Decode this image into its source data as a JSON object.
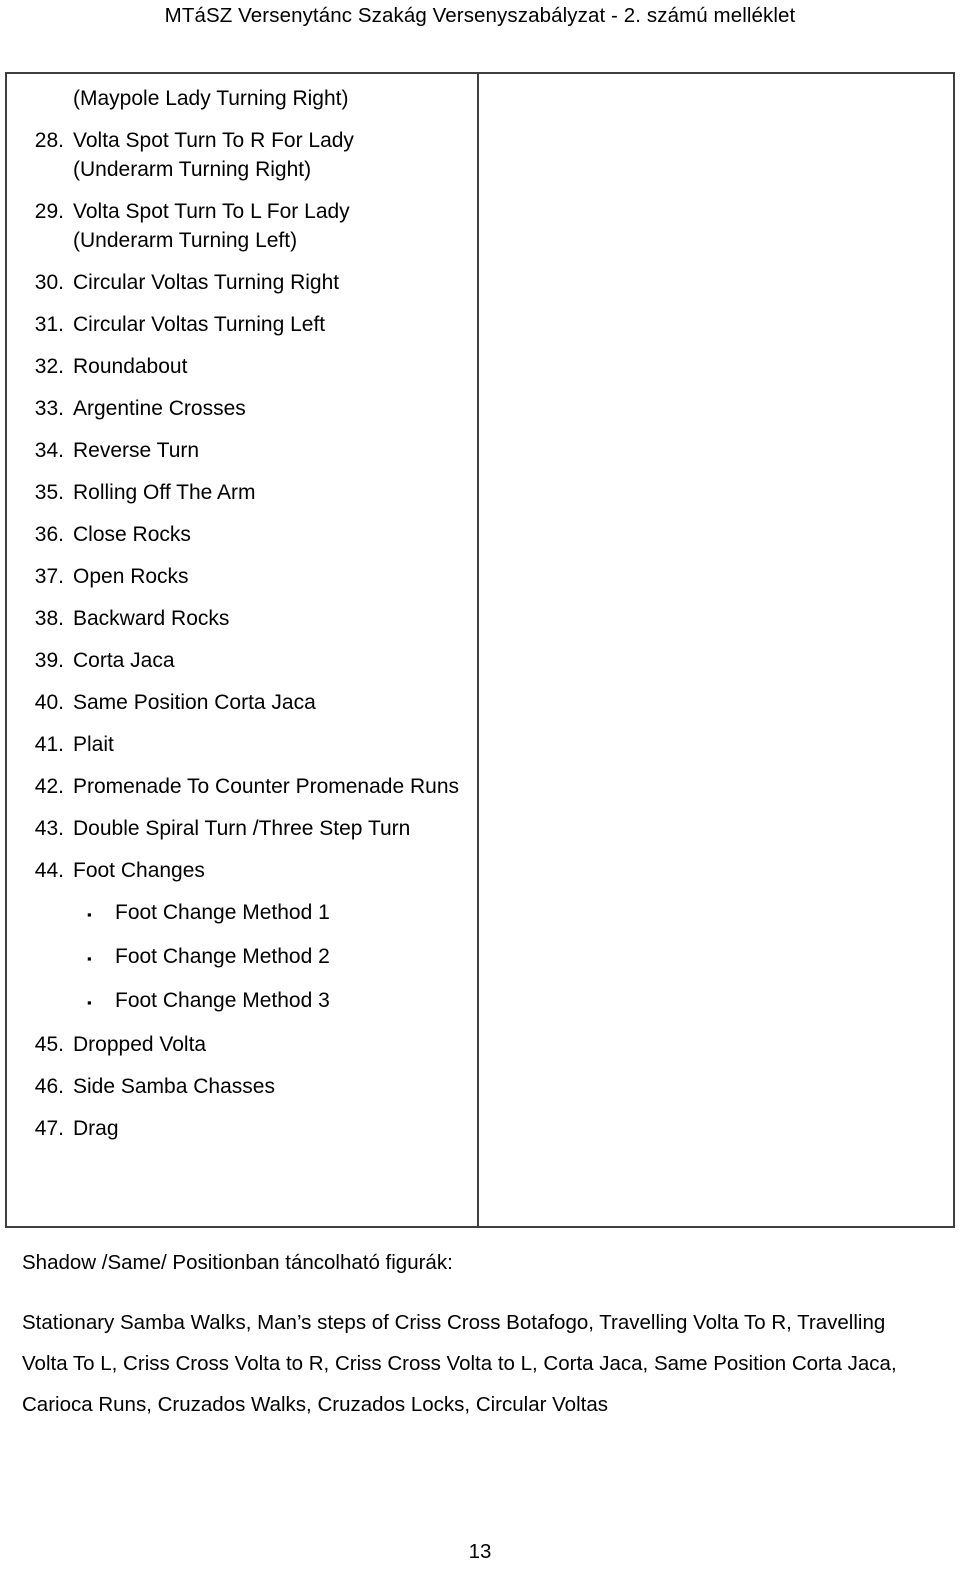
{
  "header": {
    "title": "MTáSZ Versenytánc Szakág Versenyszabályzat - 2. számú melléklet"
  },
  "table": {
    "left_column": {
      "leading_line": "(Maypole Lady Turning Right)",
      "items": [
        {
          "num": "28.",
          "label": "Volta Spot Turn To R For Lady",
          "cont": "(Underarm Turning Right)"
        },
        {
          "num": "29.",
          "label": "Volta Spot Turn To L For Lady",
          "cont": "(Underarm Turning Left)"
        },
        {
          "num": "30.",
          "label": "Circular Voltas Turning Right"
        },
        {
          "num": "31.",
          "label": "Circular Voltas Turning Left"
        },
        {
          "num": "32.",
          "label": "Roundabout"
        },
        {
          "num": "33.",
          "label": "Argentine Crosses"
        },
        {
          "num": "34.",
          "label": "Reverse Turn"
        },
        {
          "num": "35.",
          "label": "Rolling Off The Arm"
        },
        {
          "num": "36.",
          "label": "Close Rocks"
        },
        {
          "num": "37.",
          "label": "Open Rocks"
        },
        {
          "num": "38.",
          "label": "Backward Rocks"
        },
        {
          "num": "39.",
          "label": "Corta Jaca"
        },
        {
          "num": "40.",
          "label": "Same Position Corta Jaca"
        },
        {
          "num": "41.",
          "label": "Plait"
        },
        {
          "num": "42.",
          "label": "Promenade To Counter Promenade Runs"
        },
        {
          "num": "43.",
          "label": "Double Spiral Turn /Three Step Turn"
        },
        {
          "num": "44.",
          "label": "Foot Changes"
        }
      ],
      "sub_items": [
        {
          "bullet": "▪",
          "label": "Foot Change Method 1"
        },
        {
          "bullet": "▪",
          "label": "Foot Change Method 2"
        },
        {
          "bullet": "▪",
          "label": "Foot Change Method 3"
        }
      ],
      "items_after_sub": [
        {
          "num": "45.",
          "label": "Dropped Volta"
        },
        {
          "num": "46.",
          "label": "Side Samba Chasses"
        },
        {
          "num": "47.",
          "label": "Drag"
        }
      ]
    },
    "right_column": {
      "content": ""
    }
  },
  "closing": {
    "lead": "Shadow /Same/ Positionban táncolható figurák:",
    "body": "Stationary Samba Walks, Man’s steps of Criss Cross Botafogo, Travelling Volta To R, Travelling Volta To L, Criss Cross Volta to R, Criss Cross Volta to L, Corta Jaca, Same Position Corta Jaca, Carioca Runs, Cruzados Walks, Cruzados Locks, Circular Voltas"
  },
  "footer": {
    "page_number": "13"
  },
  "colors": {
    "text": "#000000",
    "table_border": "#3f3f3f",
    "background": "#ffffff"
  }
}
